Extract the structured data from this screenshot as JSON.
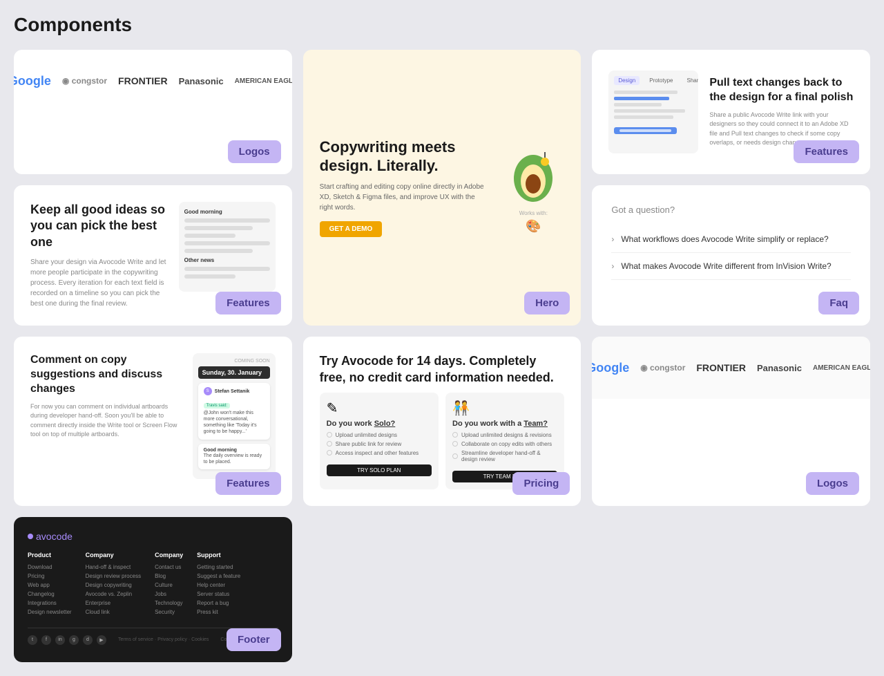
{
  "page": {
    "title": "Components"
  },
  "cards": {
    "logos1": {
      "badge": "Logos",
      "logos": [
        "Google",
        "congstor",
        "FRONTIER",
        "Panasonic",
        "AMERICAN EAGLE"
      ]
    },
    "features1": {
      "badge": "Features",
      "heading": "Keep all good ideas so you can pick the best one",
      "description": "Share your design via Avocode Write and let more people participate in the copywriting process. Every iteration for each text field is recorded on a timeline so you can pick the best one during the final review."
    },
    "hero": {
      "badge": "Hero",
      "heading": "Copywriting meets design. Literally.",
      "description": "Start crafting and editing copy online directly in Adobe XD, Sketch & Figma files, and improve UX with the right words.",
      "cta": "GET A DEMO",
      "works_with": "Works with:"
    },
    "features2": {
      "badge": "Features",
      "heading": "Pull text changes back to the design for a final polish",
      "description": "Share a public Avocode Write link with your designers so they could connect it to an Adobe XD file and Pull text changes to check if some copy overlaps, or needs design changes.",
      "tabs": [
        "Design",
        "Prototype",
        "Share"
      ]
    },
    "faq": {
      "badge": "Faq",
      "heading": "Got a question?",
      "items": [
        "What workflows does Avocode Write simplify or replace?",
        "What makes Avocode Write different from InVision Write?"
      ]
    },
    "features3": {
      "badge": "Features",
      "heading": "Comment on copy suggestions and discuss changes",
      "description": "For now you can comment on individual artboards during developer hand-off. Soon you'll be able to comment directly inside the Write tool or Screen Flow tool on top of multiple artboards.",
      "comment": {
        "name": "Stefan Settanik",
        "date": "Sunday, 30. January",
        "text": "@John won't make this more conversational, something like 'Today it's going to be happy...'",
        "label": "Travis said:",
        "reply": "Good morning\nThe daily overview is ready to be placed."
      }
    },
    "pricing": {
      "badge": "Pricing",
      "heading": "Try Avocode for 14 days. Completely free, no credit card information needed.",
      "plans": [
        {
          "title": "Do you work Solo?",
          "icon": "✎",
          "features": [
            "Upload unlimited designs",
            "Share public link for review",
            "Access inspect and other features"
          ],
          "btn": "TRY SOLO PLAN"
        },
        {
          "title": "Do you work with a Team?",
          "icon": "👥",
          "features": [
            "Upload unlimited designs & revisions",
            "Collaborate on copy edits with others",
            "Streamline developer hand-off & design review"
          ],
          "btn": "TRY TEAM PLAN"
        }
      ]
    },
    "logos2": {
      "badge": "Logos",
      "logos": [
        "Google",
        "congstor",
        "FRONTIER",
        "Panasonic",
        "AMERICAN EAGLE"
      ]
    },
    "footer": {
      "badge": "Footer",
      "logo": "avocode",
      "columns": [
        {
          "heading": "Product",
          "links": [
            "Download",
            "Pricing",
            "Web app",
            "Changelog",
            "Integrations",
            "Design newsletter"
          ]
        },
        {
          "heading": "Company",
          "links": [
            "Hand-off & Inspect",
            "Design review process",
            "Design copywriting",
            "Avocode vs. Zeplin",
            "Enterprise",
            "Cloud link"
          ]
        },
        {
          "heading": "Company",
          "links": [
            "Contact us",
            "Blog",
            "Culture",
            "Jobs",
            "Technology",
            "Security"
          ]
        },
        {
          "heading": "Support",
          "links": [
            "Getting started",
            "Suggest a feature",
            "Help center",
            "Server status",
            "Report a bug",
            "Press kit"
          ]
        }
      ],
      "socials": [
        "t",
        "f",
        "in",
        "g",
        "d",
        "yt"
      ],
      "legal": "Terms of service · Privacy policy · Cookies",
      "copyright": "Copyright © 2020 Avocode"
    }
  }
}
